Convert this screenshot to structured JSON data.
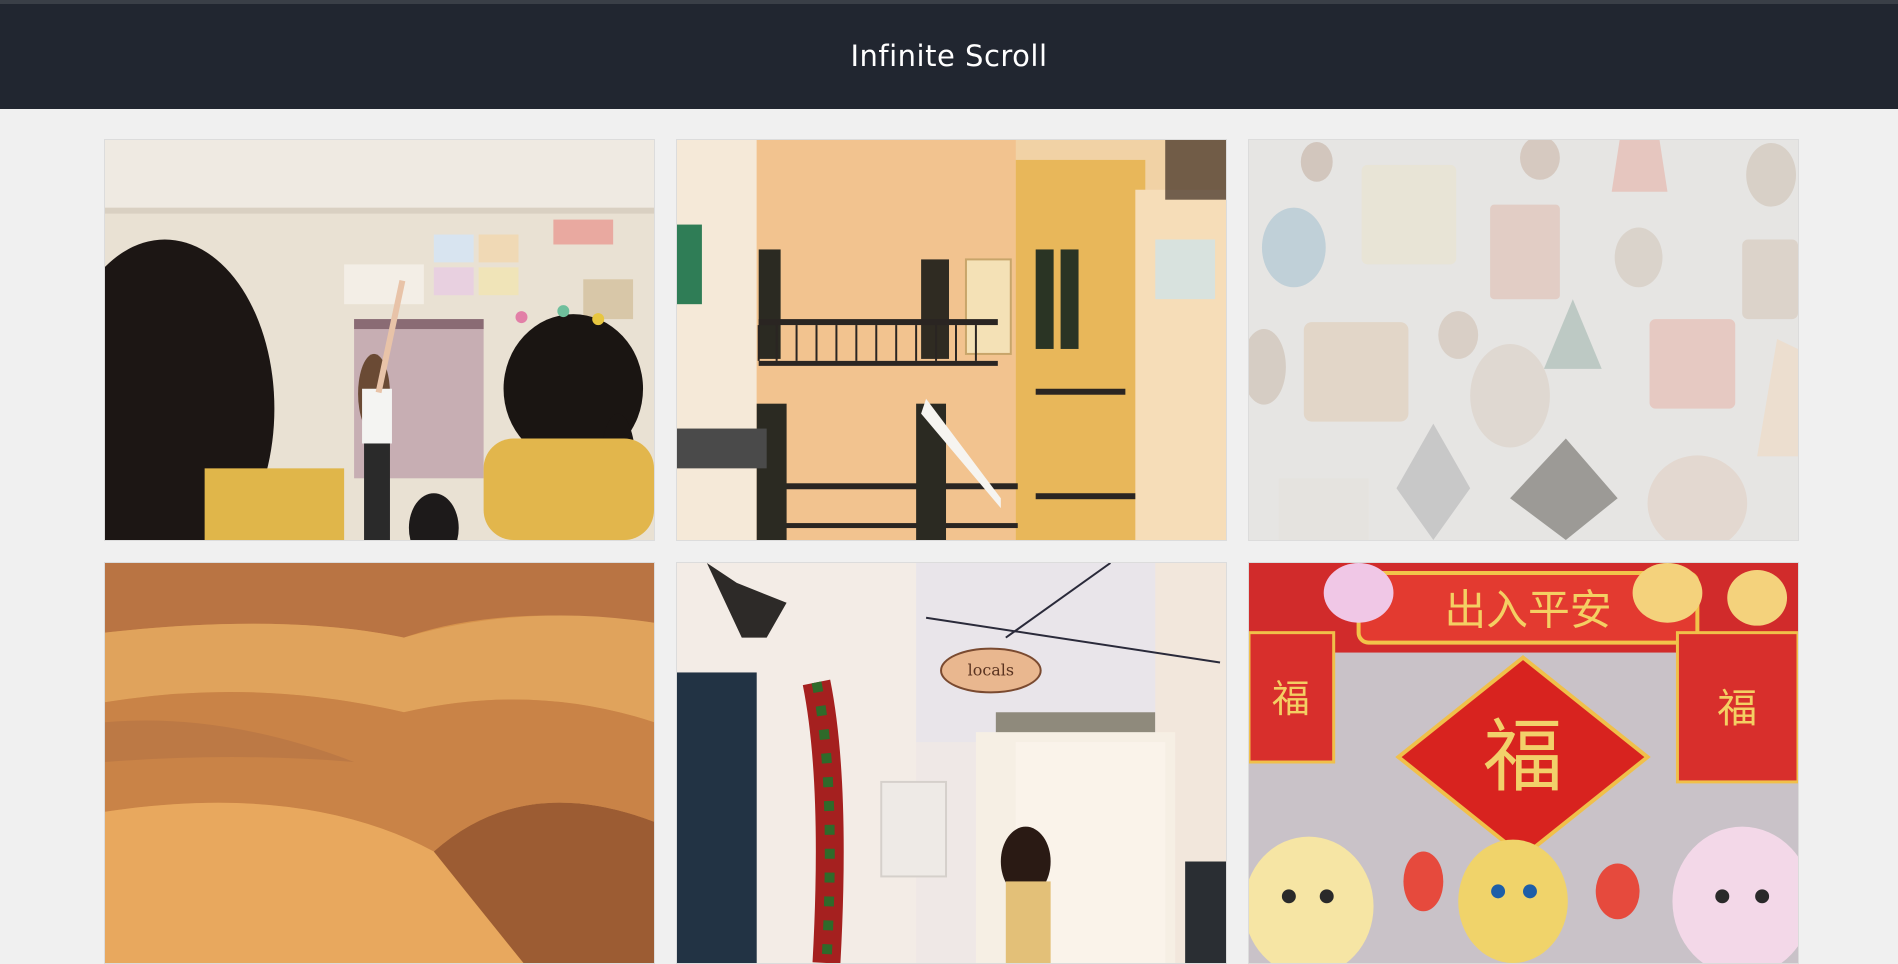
{
  "header": {
    "title": "Infinite Scroll"
  },
  "gallery": {
    "images": [
      {
        "name": "classroom-photo"
      },
      {
        "name": "building-balconies-photo"
      },
      {
        "name": "geometric-shapes-photo"
      },
      {
        "name": "desert-dunes-photo",
        "sign_text": ""
      },
      {
        "name": "alley-storefront-photo",
        "sign_text": "locals"
      },
      {
        "name": "lunar-new-year-decorations-photo",
        "banner_text": "出入平安",
        "center_text": "福",
        "side_left_text": "福",
        "side_right_text": "福"
      }
    ]
  },
  "colors": {
    "header_bg": "#212630",
    "page_bg": "#f0f0f0",
    "card_border": "#dcdcdc"
  }
}
